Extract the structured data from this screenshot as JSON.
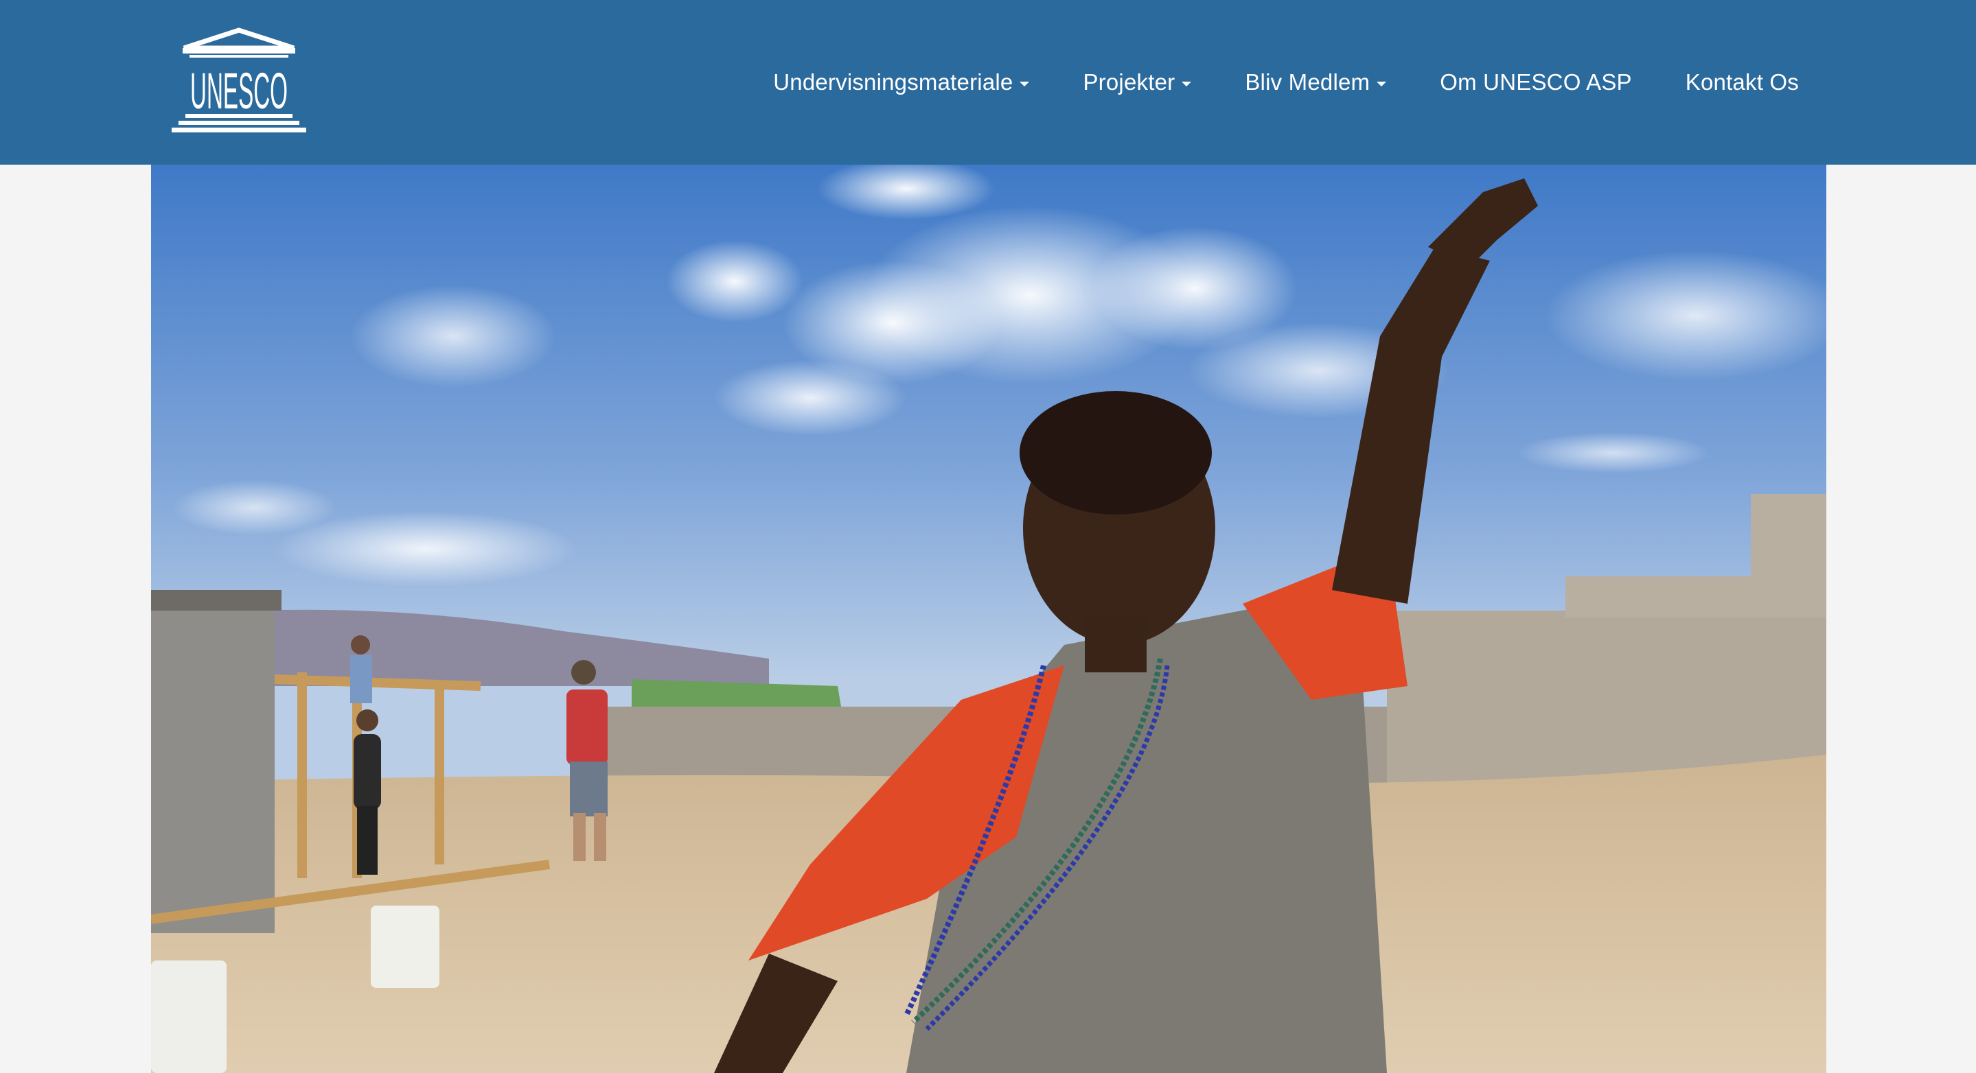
{
  "logo": {
    "text": "UNESCO",
    "icon": "unesco-temple-logo"
  },
  "nav": {
    "items": [
      {
        "label": "Undervisningsmateriale",
        "dropdown": true
      },
      {
        "label": "Projekter",
        "dropdown": true
      },
      {
        "label": "Bliv Medlem",
        "dropdown": true
      },
      {
        "label": "Om UNESCO ASP",
        "dropdown": false
      },
      {
        "label": "Kontakt Os",
        "dropdown": false
      }
    ]
  },
  "hero": {
    "description_icon": "hero-photo"
  },
  "colors": {
    "header_bg": "#2b6a9d",
    "page_bg": "#f4f4f4",
    "nav_text": "#ffffff"
  }
}
